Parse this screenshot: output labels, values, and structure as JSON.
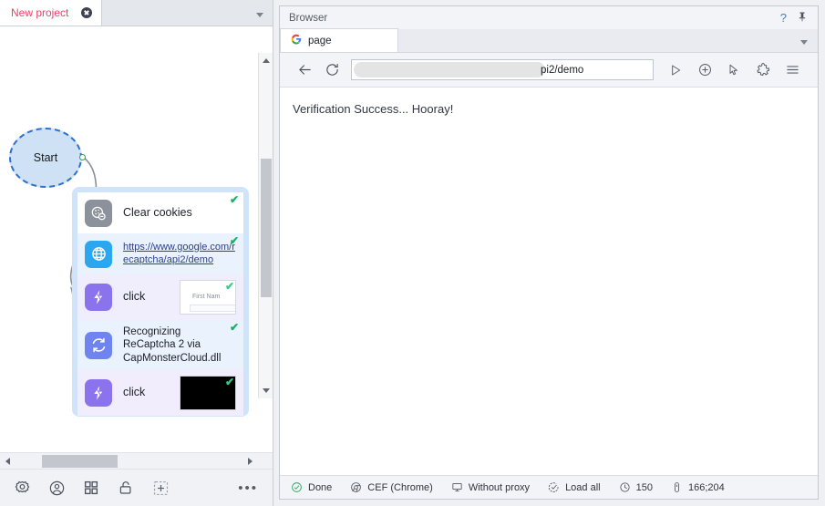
{
  "project_panel": {
    "tab": {
      "label": "New project",
      "close_icon": "close-circle-icon"
    },
    "overflow_caret": "chevron-down-icon",
    "workflow": {
      "start_node": {
        "label": "Start"
      },
      "nodes": [
        {
          "icon": "cookie-icon",
          "label": "Clear cookies",
          "status": "✔",
          "has_thumbnail": false
        },
        {
          "icon": "globe-icon",
          "label": "https://www.google.com/recaptcha/api2/demo",
          "status": "✔",
          "has_thumbnail": false
        },
        {
          "icon": "lightning-bolt-icon",
          "label": "click",
          "status": "✔",
          "has_thumbnail": true,
          "thumbnail_text": "First Nam"
        },
        {
          "icon": "sync-refresh-icon",
          "label": "Recognizing ReCaptcha 2 via CapMonsterCloud.dll",
          "status": "✔",
          "has_thumbnail": false
        },
        {
          "icon": "lightning-bolt-icon",
          "label": "click",
          "status": "✔",
          "has_thumbnail": true,
          "thumbnail_text": ""
        }
      ]
    },
    "toolbar": {
      "icons": [
        "settings-gear-icon",
        "user-profile-icon",
        "apps-grid-icon",
        "lock-icon",
        "add-plus-icon"
      ],
      "more_label": "•••"
    }
  },
  "browser_panel": {
    "header": {
      "title": "Browser",
      "help_label": "?",
      "pin_icon": "pin-icon"
    },
    "tabs": [
      {
        "favicon": "google-g-icon",
        "label": "page"
      }
    ],
    "tabs_caret": "chevron-down-icon",
    "toolbar": {
      "back_icon": "arrow-left-icon",
      "reload_icon": "reload-icon",
      "url_value": "pi2/demo",
      "buttons": [
        "play-icon",
        "plus-circle-icon",
        "cursor-pointer-icon",
        "puzzle-extension-icon",
        "hamburger-menu-icon"
      ]
    },
    "page": {
      "content": "Verification Success... Hooray!"
    },
    "statusbar": [
      {
        "icon": "check-circle-icon",
        "label": "Done"
      },
      {
        "icon": "chrome-icon",
        "label": "CEF (Chrome)"
      },
      {
        "icon": "monitor-icon",
        "label": "Without proxy"
      },
      {
        "icon": "check-dashed-icon",
        "label": "Load all"
      },
      {
        "icon": "clock-icon",
        "label": "150"
      },
      {
        "icon": "resolution-icon",
        "label": "166;204"
      }
    ]
  },
  "colors": {
    "accent_red": "#e8446a",
    "start_blue": "#2f6fd0",
    "group_blue": "#cfe3fb",
    "bolt_purple": "#8b73ee",
    "globe_blue": "#2ba7ef",
    "check_green": "#18b161"
  }
}
